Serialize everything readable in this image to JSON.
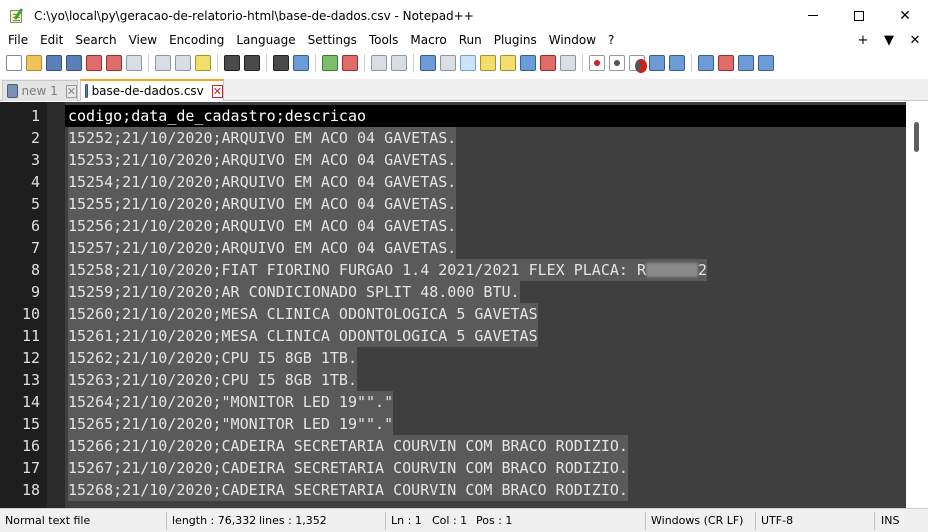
{
  "window": {
    "title": "C:\\yo\\local\\py\\geracao-de-relatorio-html\\base-de-dados.csv - Notepad++",
    "min_symbol": "",
    "max_symbol": "",
    "close_symbol": "✕"
  },
  "menu": {
    "items": [
      "File",
      "Edit",
      "Search",
      "View",
      "Encoding",
      "Language",
      "Settings",
      "Tools",
      "Macro",
      "Run",
      "Plugins",
      "Window",
      "?"
    ],
    "right": [
      "+",
      "▼",
      "✕"
    ]
  },
  "toolbar": {
    "icons": [
      "new-file-icon",
      "open-folder-icon",
      "save-icon",
      "save-all-icon",
      "close-icon",
      "close-all-icon",
      "print-icon",
      "cut-icon",
      "copy-icon",
      "paste-icon",
      "undo-icon",
      "redo-icon",
      "find-icon",
      "replace-icon",
      "zoom-in-icon",
      "zoom-out-icon",
      "sync-v-icon",
      "sync-h-icon",
      "word-wrap-icon",
      "show-all-chars-icon",
      "indent-guide-icon",
      "udl-icon",
      "doc-map-icon",
      "function-list-icon",
      "folder-as-workspace-icon",
      "monitoring-icon",
      "record-macro-icon",
      "stop-record-icon",
      "play-macro-icon",
      "run-macro-multiple-icon",
      "save-macro-icon"
    ]
  },
  "tabs": [
    {
      "label": "new 1",
      "active": false,
      "close": "✕"
    },
    {
      "label": "base-de-dados.csv",
      "active": true,
      "close": "✕"
    }
  ],
  "editor": {
    "lines": [
      {
        "num": "1",
        "text": "codigo;data_de_cadastro;descricao"
      },
      {
        "num": "2",
        "text": "15252;21/10/2020;ARQUIVO EM ACO 04 GAVETAS."
      },
      {
        "num": "3",
        "text": "15253;21/10/2020;ARQUIVO EM ACO 04 GAVETAS."
      },
      {
        "num": "4",
        "text": "15254;21/10/2020;ARQUIVO EM ACO 04 GAVETAS."
      },
      {
        "num": "5",
        "text": "15255;21/10/2020;ARQUIVO EM ACO 04 GAVETAS."
      },
      {
        "num": "6",
        "text": "15256;21/10/2020;ARQUIVO EM ACO 04 GAVETAS."
      },
      {
        "num": "7",
        "text": "15257;21/10/2020;ARQUIVO EM ACO 04 GAVETAS."
      },
      {
        "num": "8",
        "text": "15258;21/10/2020;FIAT FIORINO FURGAO 1.4 2021/2021 FLEX PLACA: R",
        "tail": "2"
      },
      {
        "num": "9",
        "text": "15259;21/10/2020;AR CONDICIONADO SPLIT 48.000 BTU."
      },
      {
        "num": "10",
        "text": "15260;21/10/2020;MESA CLINICA ODONTOLOGICA 5 GAVETAS"
      },
      {
        "num": "11",
        "text": "15261;21/10/2020;MESA CLINICA ODONTOLOGICA 5 GAVETAS"
      },
      {
        "num": "12",
        "text": "15262;21/10/2020;CPU I5 8GB 1TB."
      },
      {
        "num": "13",
        "text": "15263;21/10/2020;CPU I5 8GB 1TB."
      },
      {
        "num": "14",
        "text": "15264;21/10/2020;\"MONITOR LED 19\"\".\""
      },
      {
        "num": "15",
        "text": "15265;21/10/2020;\"MONITOR LED 19\"\".\""
      },
      {
        "num": "16",
        "text": "15266;21/10/2020;CADEIRA SECRETARIA COURVIN COM BRACO RODIZIO."
      },
      {
        "num": "17",
        "text": "15267;21/10/2020;CADEIRA SECRETARIA COURVIN COM BRACO RODIZIO."
      },
      {
        "num": "18",
        "text": "15268;21/10/2020;CADEIRA SECRETARIA COURVIN COM BRACO RODIZIO."
      }
    ]
  },
  "status": {
    "file_type": "Normal text file",
    "length": "length : 76,332",
    "lines": "lines : 1,352",
    "ln": "Ln : 1",
    "col": "Col : 1",
    "pos": "Pos : 1",
    "eol": "Windows (CR LF)",
    "encoding": "UTF-8",
    "mode": "INS"
  }
}
